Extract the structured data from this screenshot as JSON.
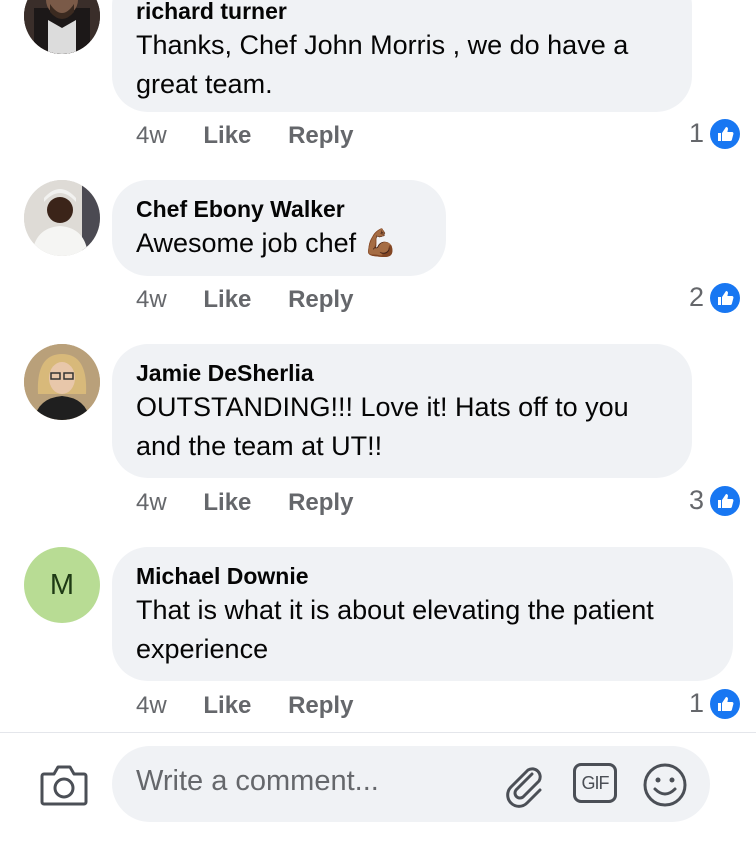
{
  "comments": [
    {
      "author": "richard turner",
      "text": "Thanks, Chef John Morris , we do have a great team.",
      "time": "4w",
      "like_label": "Like",
      "reply_label": "Reply",
      "reaction_count": "1"
    },
    {
      "author": "Chef Ebony Walker",
      "text": "Awesome job chef 💪🏾",
      "time": "4w",
      "like_label": "Like",
      "reply_label": "Reply",
      "reaction_count": "2"
    },
    {
      "author": "Jamie DeSherlia",
      "text": "OUTSTANDING!!! Love it! Hats off to you and the team at UT!!",
      "time": "4w",
      "like_label": "Like",
      "reply_label": "Reply",
      "reaction_count": "3"
    },
    {
      "author": "Michael Downie",
      "avatar_initial": "M",
      "text": "That is what it is about elevating the patient experience",
      "time": "4w",
      "like_label": "Like",
      "reply_label": "Reply",
      "reaction_count": "1"
    }
  ],
  "composer": {
    "placeholder": "Write a comment...",
    "camera_icon": "camera-icon",
    "attach_icon": "paperclip-icon",
    "gif_label": "GIF",
    "emoji_icon": "smiley-icon"
  },
  "colors": {
    "bubble_bg": "#f0f2f5",
    "meta_text": "#65676b",
    "like_blue": "#1877f2",
    "initial_avatar_bg": "#b8dc94"
  }
}
